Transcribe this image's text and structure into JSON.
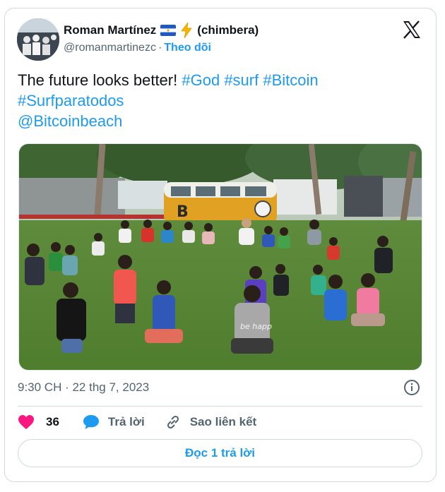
{
  "tweet": {
    "author_name": "Roman Martínez",
    "author_suffix": "(chimbera)",
    "handle": "@romanmartinezc",
    "separator": "·",
    "follow_label": "Theo dõi",
    "text_plain": "The future looks better!",
    "hashtags": [
      "#God",
      "#surf",
      "#Bitcoin",
      "#Surfparatodos"
    ],
    "mention": "@Bitcoinbeach",
    "timestamp": "9:30 CH · 22 thg 7, 2023",
    "likes": "36",
    "reply_label": "Trả lời",
    "copy_link_label": "Sao liên kết",
    "read_replies_label": "Đọc 1 trả lời"
  },
  "colors": {
    "accent": "#1d9bf0",
    "like": "#f91880",
    "text": "#0f1419",
    "muted": "#536471",
    "border": "#cfd9de"
  },
  "icons": {
    "flag": "el-salvador-flag-icon",
    "bolt": "lightning-bolt-icon",
    "platform": "x-logo-icon",
    "info": "info-icon",
    "like": "heart-icon",
    "reply": "speech-bubble-icon",
    "link": "link-icon"
  }
}
